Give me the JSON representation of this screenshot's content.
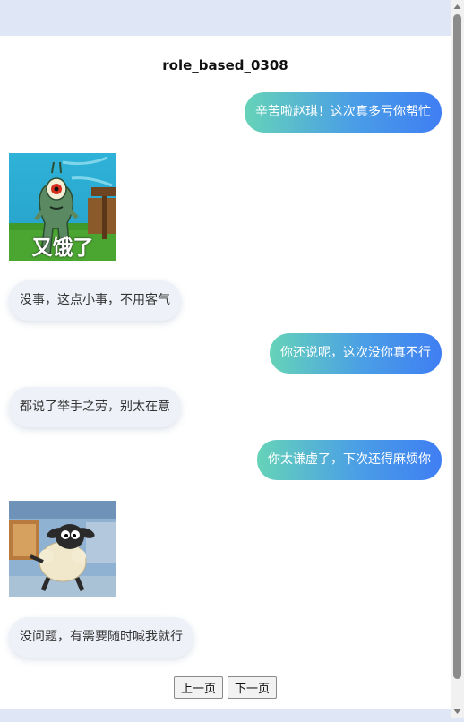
{
  "chat": {
    "title": "role_based_0308",
    "messages": [
      {
        "side": "right",
        "type": "text",
        "text": "辛苦啦赵琪！这次真多亏你帮忙"
      },
      {
        "side": "left",
        "type": "image",
        "image_name": "plankton-sticker",
        "caption": "又饿了"
      },
      {
        "side": "left",
        "type": "text",
        "text": "没事，这点小事，不用客气"
      },
      {
        "side": "right",
        "type": "text",
        "text": "你还说呢，这次没你真不行"
      },
      {
        "side": "left",
        "type": "text",
        "text": "都说了举手之劳，别太在意"
      },
      {
        "side": "right",
        "type": "text",
        "text": "你太谦虚了，下次还得麻烦你"
      },
      {
        "side": "left",
        "type": "image",
        "image_name": "shaun-the-sheep-sticker"
      },
      {
        "side": "left",
        "type": "text",
        "text": "没问题，有需要随时喊我就行"
      }
    ]
  },
  "pager": {
    "prev_label": "上一页",
    "next_label": "下一页"
  },
  "colors": {
    "page_bg": "#dfe7f6",
    "card_bg": "#ffffff",
    "bubble_gradient_start": "#66d3b8",
    "bubble_gradient_end": "#3f7ef3",
    "left_bubble_bg": "#eef2f8"
  }
}
